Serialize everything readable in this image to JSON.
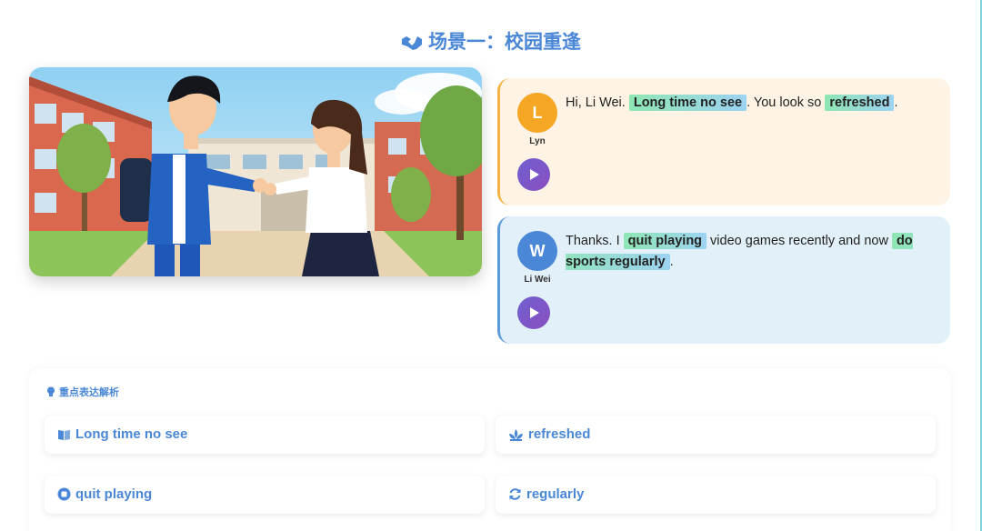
{
  "scene_title": "场景一：校园重逢",
  "dialogue": [
    {
      "initial": "L",
      "speaker": "Lyn",
      "parts": [
        {
          "text": "Hi, Li Wei. ",
          "hl": false
        },
        {
          "text": "Long time no see",
          "hl": true
        },
        {
          "text": ". You look so ",
          "hl": false
        },
        {
          "text": "refreshed",
          "hl": true
        },
        {
          "text": ".",
          "hl": false
        }
      ]
    },
    {
      "initial": "W",
      "speaker": "Li Wei",
      "parts": [
        {
          "text": "Thanks. I ",
          "hl": false
        },
        {
          "text": "quit playing",
          "hl": true
        },
        {
          "text": " video games recently and now ",
          "hl": false
        },
        {
          "text": "do sports regularly",
          "hl": true
        },
        {
          "text": ".",
          "hl": false
        }
      ]
    }
  ],
  "analysis": {
    "title": "重点表达解析",
    "cards": [
      {
        "label": "Long time no see",
        "icon": "book-icon"
      },
      {
        "label": "refreshed",
        "icon": "lotus-icon"
      },
      {
        "label": "quit playing",
        "icon": "stop-circle-icon"
      },
      {
        "label": "regularly",
        "icon": "refresh-icon"
      }
    ]
  },
  "colors": {
    "accent": "#4a87d6",
    "lyn_bg": "#fff3e5",
    "lyn_border": "#f5b342",
    "wei_bg": "#e2f0f9",
    "wei_border": "#5b9ad8",
    "highlight_from": "#8fe6b4",
    "highlight_to": "#9dd3f2"
  }
}
